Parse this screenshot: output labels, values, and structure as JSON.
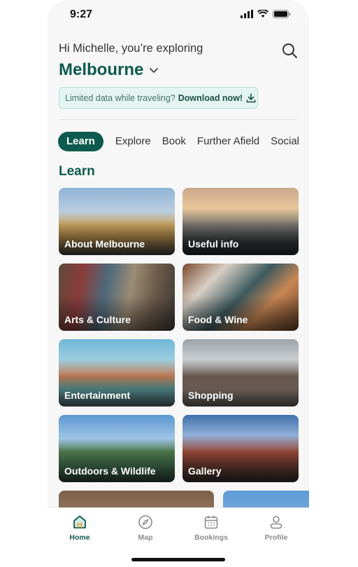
{
  "status": {
    "time": "9:27"
  },
  "header": {
    "greeting": "Hi Michelle, you’re exploring",
    "city": "Melbourne",
    "banner_text": "Limited data while traveling?",
    "banner_link": "Download now!"
  },
  "tabs": [
    "Learn",
    "Explore",
    "Book",
    "Further Afield",
    "Social"
  ],
  "section_title": "Learn",
  "cards": [
    {
      "label": "About Melbourne"
    },
    {
      "label": "Useful info"
    },
    {
      "label": "Arts & Culture"
    },
    {
      "label": "Food & Wine"
    },
    {
      "label": "Entertainment"
    },
    {
      "label": "Shopping"
    },
    {
      "label": "Outdoors & Wildlife"
    },
    {
      "label": "Gallery"
    }
  ],
  "tabbar": [
    "Home",
    "Map",
    "Bookings",
    "Profile"
  ],
  "colors": {
    "accent": "#0e5a4f",
    "banner_bg": "#e4f5f1",
    "inactive": "#8a8a8a"
  },
  "icons": [
    "search-icon",
    "chevron-down-icon",
    "download-icon",
    "home-icon",
    "compass-icon",
    "calendar-icon",
    "profile-icon"
  ]
}
